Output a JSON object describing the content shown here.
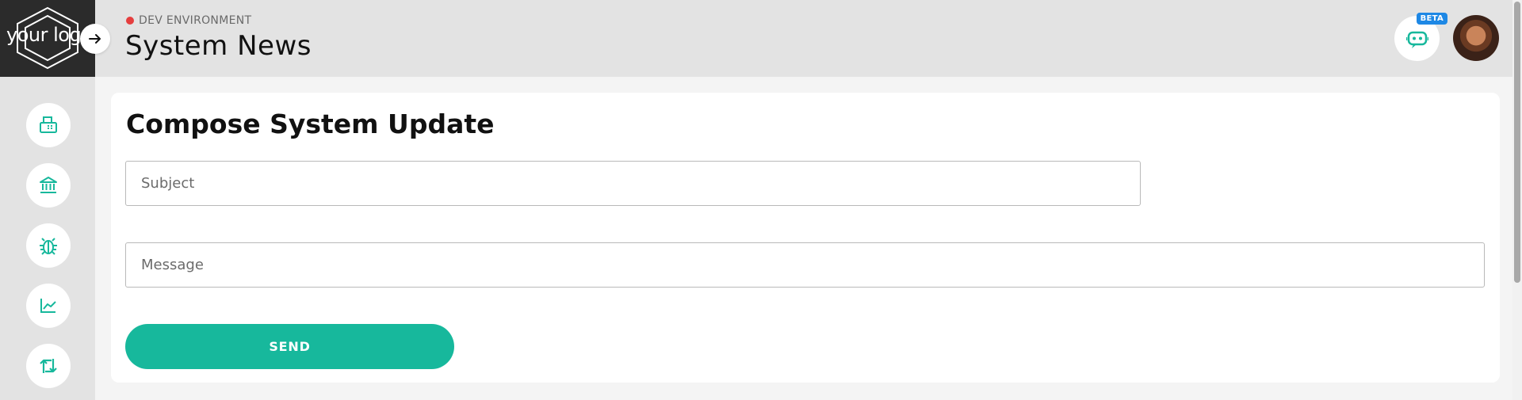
{
  "brand": {
    "logo_text": "your logo"
  },
  "header": {
    "environment": "DEV ENVIRONMENT",
    "title": "System News",
    "beta_badge": "BETA"
  },
  "sidebar": {
    "items": [
      {
        "icon": "fax-icon"
      },
      {
        "icon": "bank-icon"
      },
      {
        "icon": "bug-icon"
      },
      {
        "icon": "chart-line-icon"
      },
      {
        "icon": "repeat-icon"
      }
    ]
  },
  "compose": {
    "title": "Compose System Update",
    "subject_placeholder": "Subject",
    "message_placeholder": "Message",
    "send_label": "SEND"
  },
  "colors": {
    "accent": "#17b89c",
    "env_dot": "#e53e3e",
    "beta": "#1e88e5"
  }
}
